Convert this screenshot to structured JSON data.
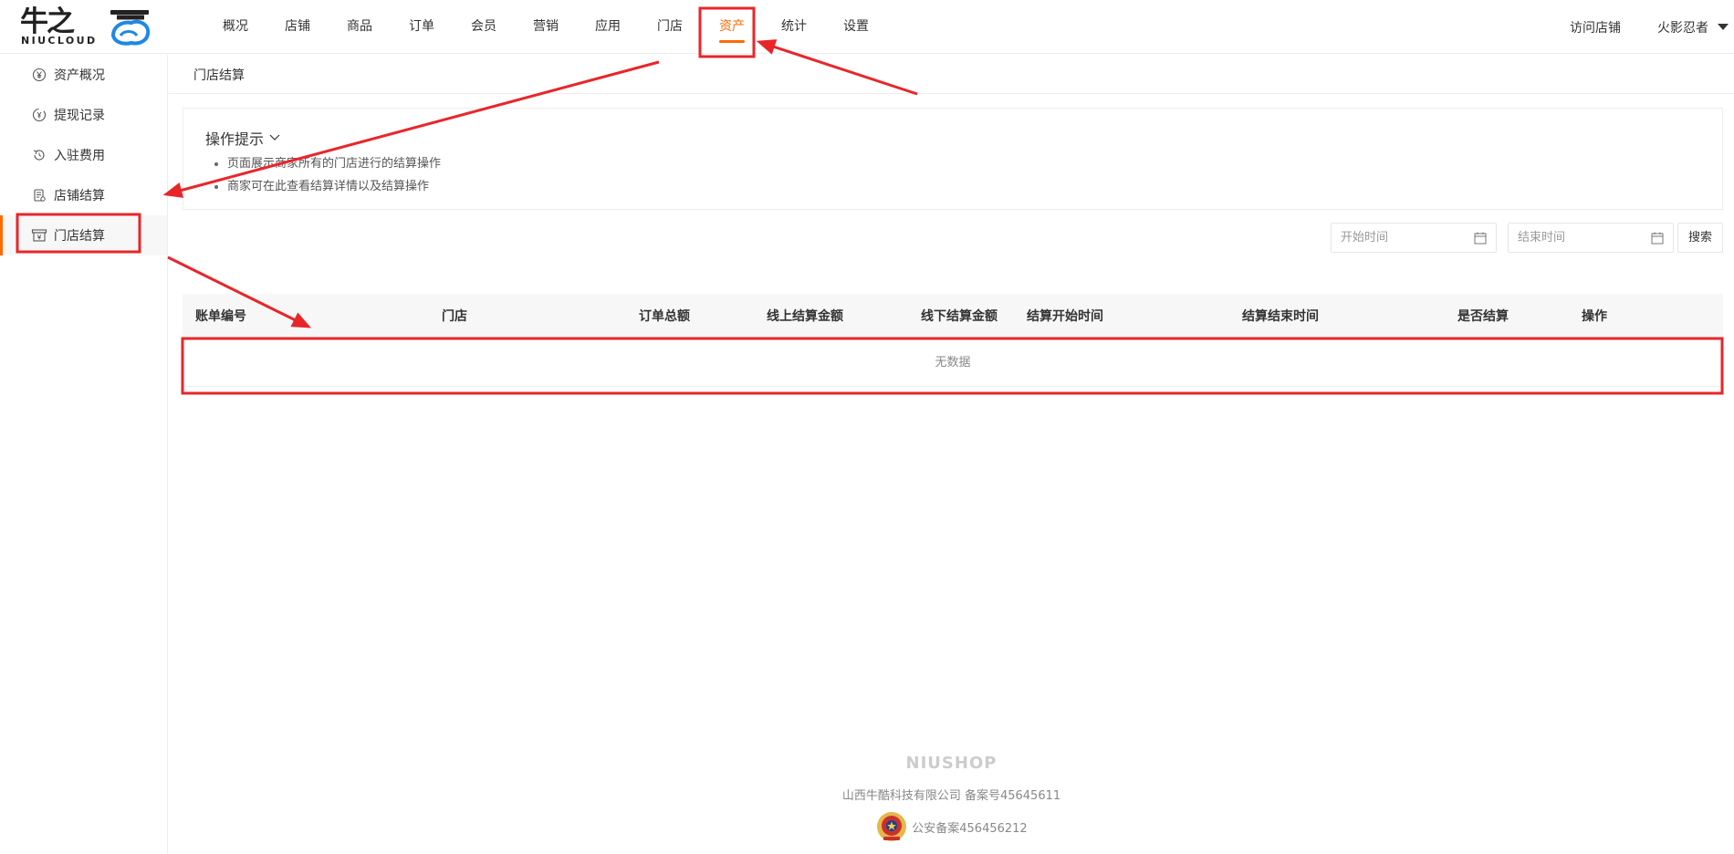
{
  "logo": {
    "cn": "牛之",
    "en": "NIUCLOUD"
  },
  "nav": {
    "items": [
      {
        "label": "概况"
      },
      {
        "label": "店铺"
      },
      {
        "label": "商品"
      },
      {
        "label": "订单"
      },
      {
        "label": "会员"
      },
      {
        "label": "营销"
      },
      {
        "label": "应用"
      },
      {
        "label": "门店"
      },
      {
        "label": "资产",
        "active": true
      },
      {
        "label": "统计"
      },
      {
        "label": "设置"
      }
    ]
  },
  "header_right": {
    "visit_store": "访问店铺",
    "user": "火影忍者"
  },
  "sidebar": {
    "items": [
      {
        "label": "资产概况",
        "icon": "yen-circle-icon"
      },
      {
        "label": "提现记录",
        "icon": "withdraw-icon"
      },
      {
        "label": "入驻费用",
        "icon": "refund-icon"
      },
      {
        "label": "店铺结算",
        "icon": "document-icon"
      },
      {
        "label": "门店结算",
        "icon": "store-settle-icon",
        "active": true
      }
    ]
  },
  "breadcrumb": "门店结算",
  "tips": {
    "title": "操作提示",
    "lines": [
      "页面展示商家所有的门店进行的结算操作",
      "商家可在此查看结算详情以及结算操作"
    ]
  },
  "filters": {
    "start_placeholder": "开始时间",
    "end_placeholder": "结束时间",
    "search_label": "搜索"
  },
  "table": {
    "headers": [
      "账单编号",
      "门店",
      "订单总额",
      "线上结算金额",
      "线下结算金额",
      "结算开始时间",
      "结算结束时间",
      "是否结算",
      "操作"
    ],
    "empty_text": "无数据"
  },
  "footer": {
    "brand": "NIUSHOP",
    "company": "山西牛酷科技有限公司  备案号45645611",
    "police": "公安备案456456212"
  },
  "colors": {
    "accent": "#ff6a00",
    "annotation": "#e8262a"
  }
}
